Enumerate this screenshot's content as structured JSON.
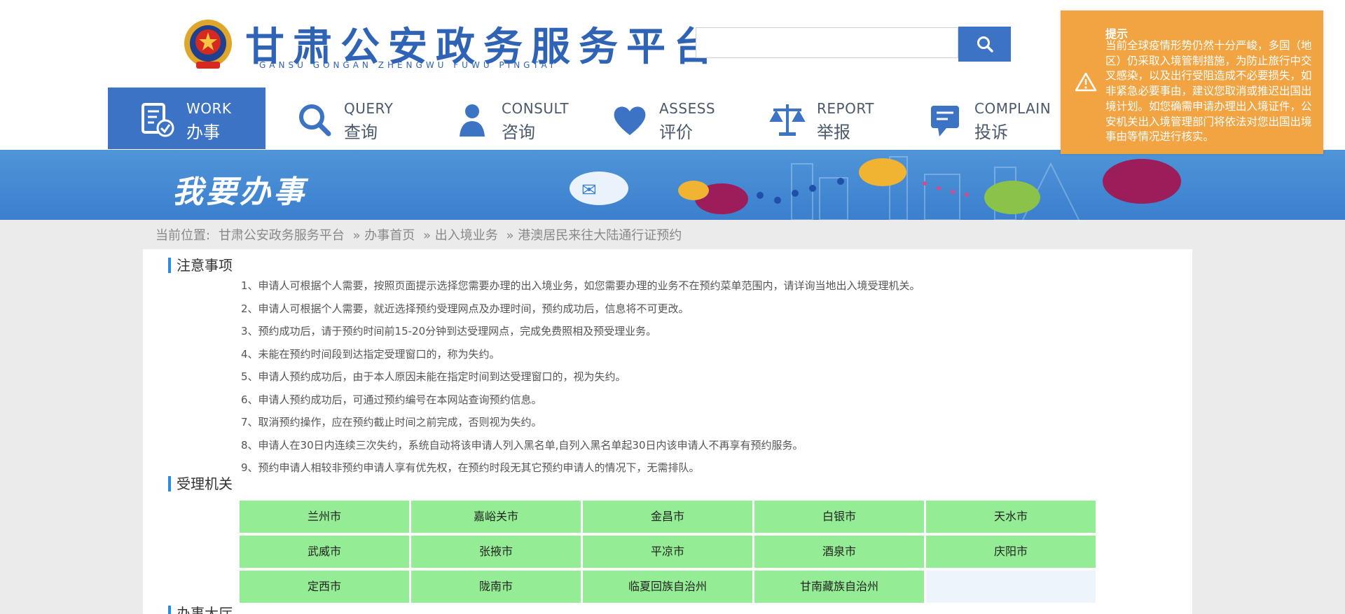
{
  "header": {
    "title": "甘肃公安政务服务平台",
    "pinyin": "GANSU GONGAN ZHENGWU FUWU PINGTAI",
    "search_placeholder": ""
  },
  "nav": [
    {
      "en": "WORK",
      "cn": "办事",
      "icon": "document-check-icon",
      "active": true
    },
    {
      "en": "QUERY",
      "cn": "查询",
      "icon": "search-icon",
      "active": false
    },
    {
      "en": "CONSULT",
      "cn": "咨询",
      "icon": "person-icon",
      "active": false
    },
    {
      "en": "ASSESS",
      "cn": "评价",
      "icon": "heart-icon",
      "active": false
    },
    {
      "en": "REPORT",
      "cn": "举报",
      "icon": "scales-icon",
      "active": false
    },
    {
      "en": "COMPLAIN",
      "cn": "投诉",
      "icon": "chat-bubble-icon",
      "active": false
    }
  ],
  "banner": {
    "title": "我要办事"
  },
  "breadcrumb": {
    "label": "当前位置:",
    "items": [
      "甘肃公安政务服务平台",
      "» 办事首页",
      "» 出入境业务",
      "» 港澳居民来往大陆通行证预约"
    ]
  },
  "notice": {
    "title": "注意事项",
    "items": [
      "1、申请人可根据个人需要，按照页面提示选择您需要办理的出入境业务，如您需要办理的业务不在预约菜单范围内，请详询当地出入境受理机关。",
      "2、申请人可根据个人需要，就近选择预约受理网点及办理时间，预约成功后，信息将不可更改。",
      "3、预约成功后，请于预约时间前15-20分钟到达受理网点，完成免费照相及预受理业务。",
      "4、未能在预约时间段到达指定受理窗口的，称为失约。",
      "5、申请人预约成功后，由于本人原因未能在指定时间到达受理窗口的，视为失约。",
      "6、申请人预约成功后，可通过预约编号在本网站查询预约信息。",
      "7、取消预约操作，应在预约截止时间之前完成，否则视为失约。",
      "8、申请人在30日内连续三次失约，系统自动将该申请人列入黑名单,自列入黑名单起30日内该申请人不再享有预约服务。",
      "9、预约申请人相较非预约申请人享有优先权，在预约时段无其它预约申请人的情况下，无需排队。"
    ]
  },
  "offices": {
    "title": "受理机关",
    "cities": [
      "兰州市",
      "嘉峪关市",
      "金昌市",
      "白银市",
      "天水市",
      "武威市",
      "张掖市",
      "平凉市",
      "酒泉市",
      "庆阳市",
      "定西市",
      "陇南市",
      "临夏回族自治州",
      "甘南藏族自治州"
    ]
  },
  "next_section": {
    "title": "办事大厅"
  },
  "popup": {
    "title": "提示",
    "text": "当前全球疫情形势仍然十分严峻，多国（地区）仍采取入境管制措施，为防止旅行中交叉感染，以及出行受阻造成不必要损失，如非紧急必要事由，建议您取消或推迟出国出境计划。如您确需申请办理出入境证件，公安机关出入境管理部门将依法对您出国出境事由等情况进行核实。"
  },
  "colors": {
    "brand_blue": "#3c73c4",
    "city_green": "#94ed94",
    "popup_orange": "#f2a443",
    "section_bar": "#2b8be0"
  }
}
